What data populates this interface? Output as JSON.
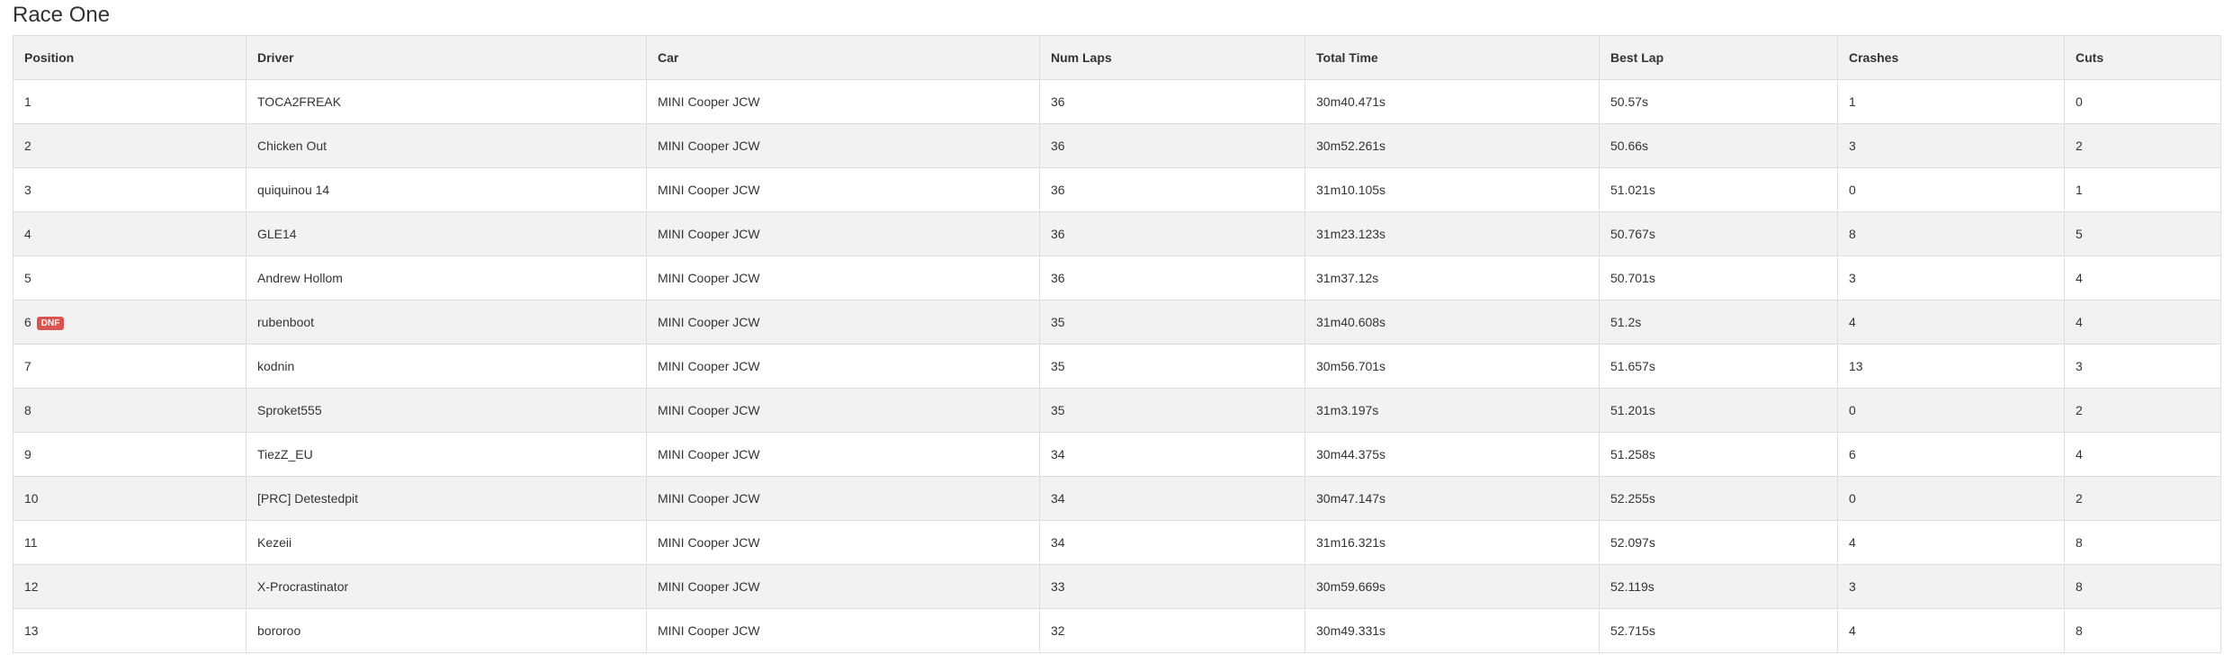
{
  "page": {
    "title": "Race One"
  },
  "table": {
    "columns": [
      "Position",
      "Driver",
      "Car",
      "Num Laps",
      "Total Time",
      "Best Lap",
      "Crashes",
      "Cuts"
    ],
    "rows": [
      {
        "position": "1",
        "badge": "",
        "driver": "TOCA2FREAK",
        "car": "MINI Cooper JCW",
        "laps": "36",
        "total_time": "30m40.471s",
        "best_lap": "50.57s",
        "crashes": "1",
        "cuts": "0"
      },
      {
        "position": "2",
        "badge": "",
        "driver": "Chicken Out",
        "car": "MINI Cooper JCW",
        "laps": "36",
        "total_time": "30m52.261s",
        "best_lap": "50.66s",
        "crashes": "3",
        "cuts": "2"
      },
      {
        "position": "3",
        "badge": "",
        "driver": "quiquinou 14",
        "car": "MINI Cooper JCW",
        "laps": "36",
        "total_time": "31m10.105s",
        "best_lap": "51.021s",
        "crashes": "0",
        "cuts": "1"
      },
      {
        "position": "4",
        "badge": "",
        "driver": "GLE14",
        "car": "MINI Cooper JCW",
        "laps": "36",
        "total_time": "31m23.123s",
        "best_lap": "50.767s",
        "crashes": "8",
        "cuts": "5"
      },
      {
        "position": "5",
        "badge": "",
        "driver": "Andrew Hollom",
        "car": "MINI Cooper JCW",
        "laps": "36",
        "total_time": "31m37.12s",
        "best_lap": "50.701s",
        "crashes": "3",
        "cuts": "4"
      },
      {
        "position": "6",
        "badge": "DNF",
        "driver": "rubenboot",
        "car": "MINI Cooper JCW",
        "laps": "35",
        "total_time": "31m40.608s",
        "best_lap": "51.2s",
        "crashes": "4",
        "cuts": "4"
      },
      {
        "position": "7",
        "badge": "",
        "driver": "kodnin",
        "car": "MINI Cooper JCW",
        "laps": "35",
        "total_time": "30m56.701s",
        "best_lap": "51.657s",
        "crashes": "13",
        "cuts": "3"
      },
      {
        "position": "8",
        "badge": "",
        "driver": "Sproket555",
        "car": "MINI Cooper JCW",
        "laps": "35",
        "total_time": "31m3.197s",
        "best_lap": "51.201s",
        "crashes": "0",
        "cuts": "2"
      },
      {
        "position": "9",
        "badge": "",
        "driver": "TiezZ_EU",
        "car": "MINI Cooper JCW",
        "laps": "34",
        "total_time": "30m44.375s",
        "best_lap": "51.258s",
        "crashes": "6",
        "cuts": "4"
      },
      {
        "position": "10",
        "badge": "",
        "driver": "[PRC] Detestedpit",
        "car": "MINI Cooper JCW",
        "laps": "34",
        "total_time": "30m47.147s",
        "best_lap": "52.255s",
        "crashes": "0",
        "cuts": "2"
      },
      {
        "position": "11",
        "badge": "",
        "driver": "Kezeii",
        "car": "MINI Cooper JCW",
        "laps": "34",
        "total_time": "31m16.321s",
        "best_lap": "52.097s",
        "crashes": "4",
        "cuts": "8"
      },
      {
        "position": "12",
        "badge": "",
        "driver": "X-Procrastinator",
        "car": "MINI Cooper JCW",
        "laps": "33",
        "total_time": "30m59.669s",
        "best_lap": "52.119s",
        "crashes": "3",
        "cuts": "8"
      },
      {
        "position": "13",
        "badge": "",
        "driver": "bororoo",
        "car": "MINI Cooper JCW",
        "laps": "32",
        "total_time": "30m49.331s",
        "best_lap": "52.715s",
        "crashes": "4",
        "cuts": "8"
      }
    ]
  },
  "colors": {
    "dnf_badge": "#d9534f",
    "header_bg": "#f2f2f2",
    "stripe_bg": "#f2f2f2",
    "border": "#dddddd",
    "text": "#333333"
  }
}
